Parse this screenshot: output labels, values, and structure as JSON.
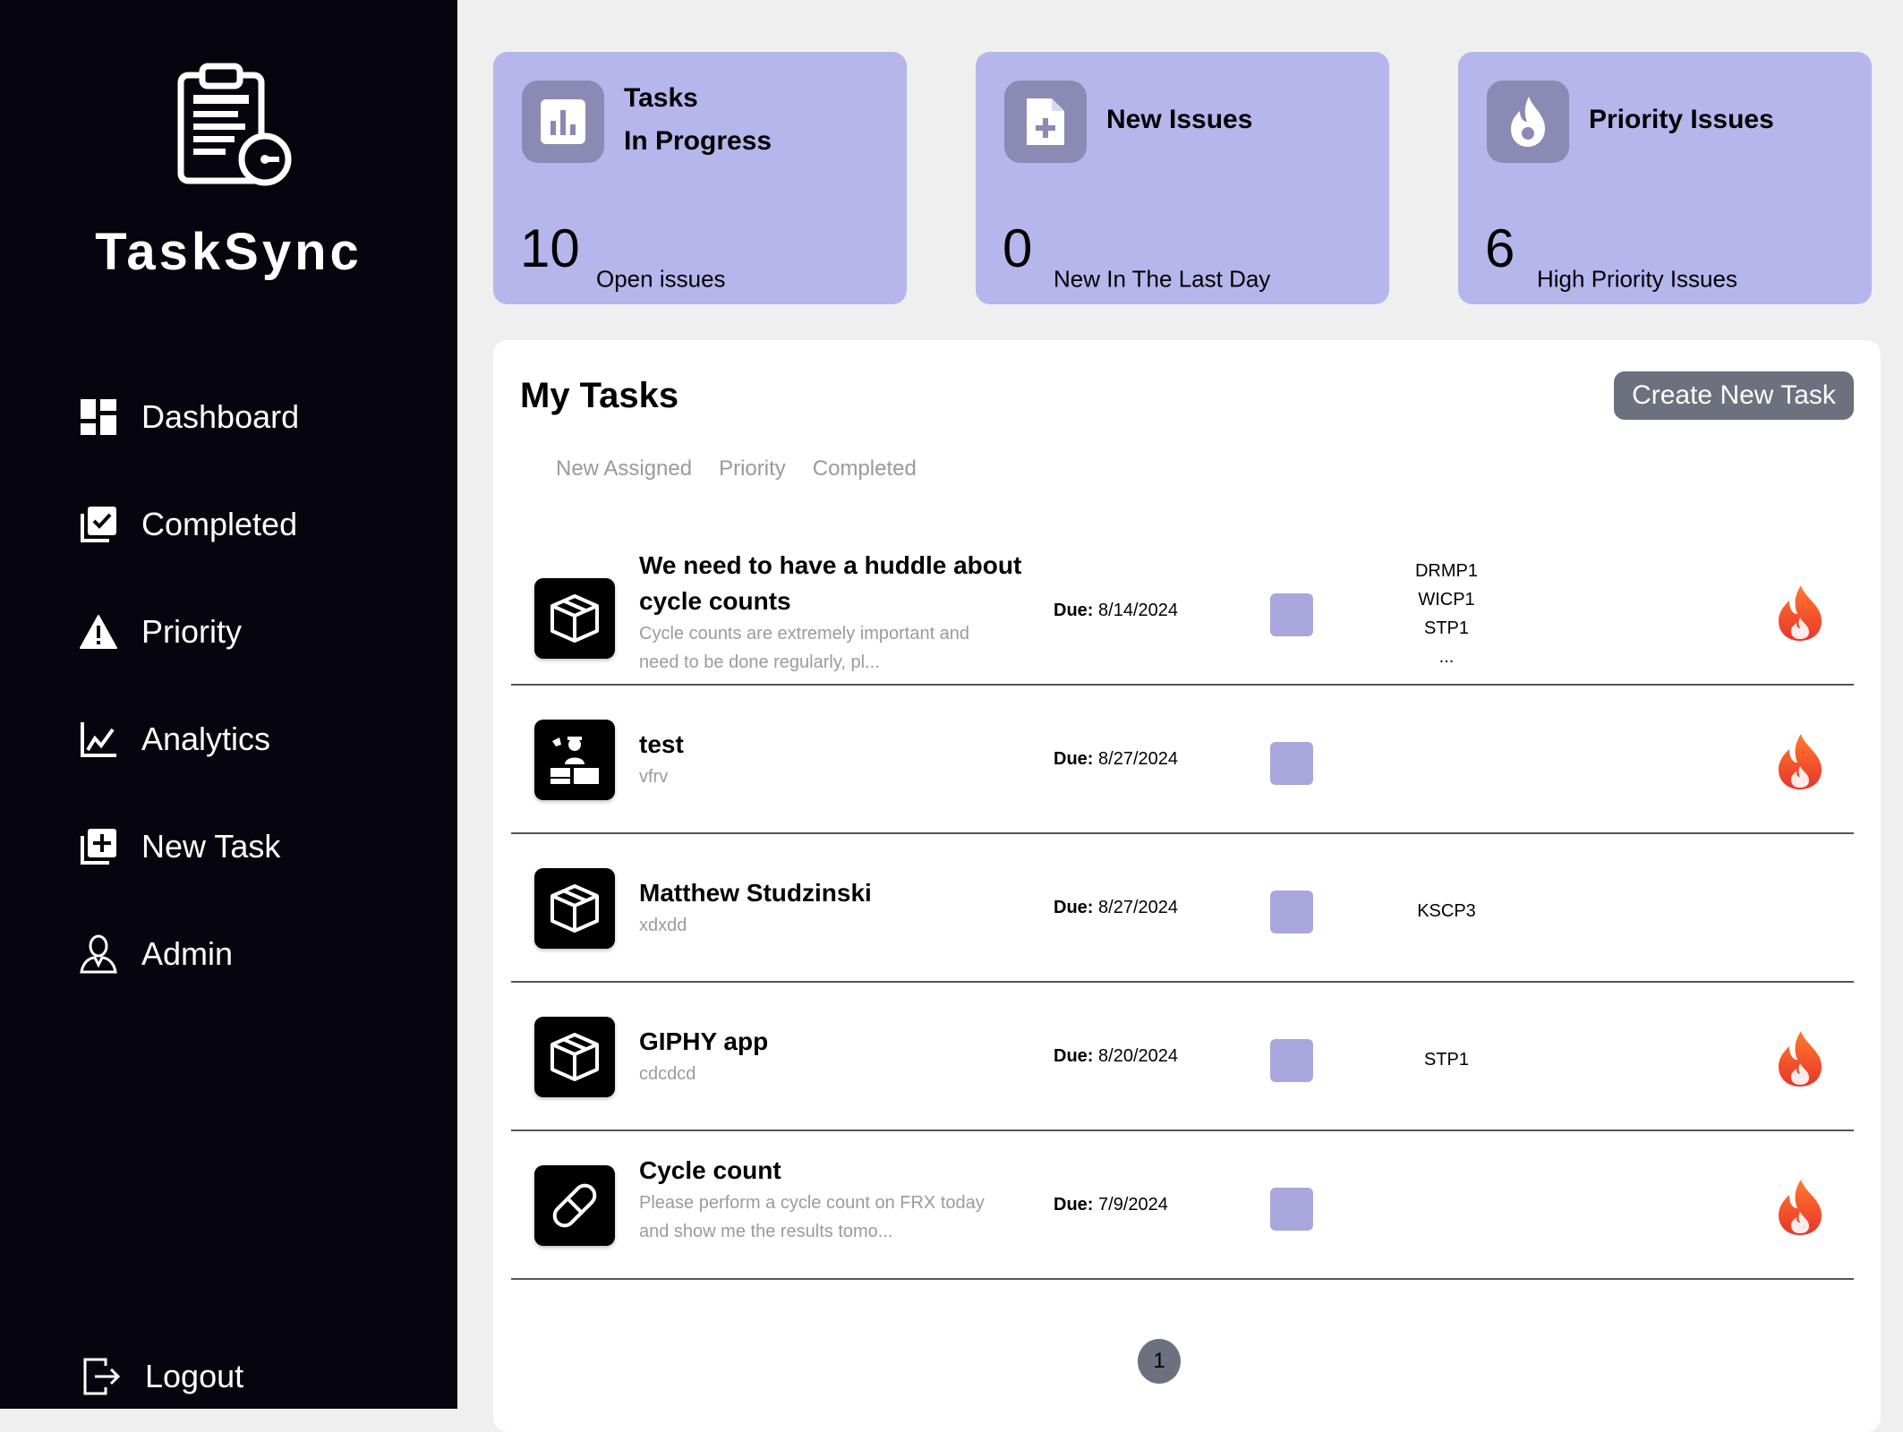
{
  "app": {
    "name": "TaskSync"
  },
  "sidebar": {
    "items": [
      {
        "label": "Dashboard",
        "icon": "dashboard-icon"
      },
      {
        "label": "Completed",
        "icon": "completed-check-icon"
      },
      {
        "label": "Priority",
        "icon": "warning-icon"
      },
      {
        "label": "Analytics",
        "icon": "analytics-chart-icon"
      },
      {
        "label": "New Task",
        "icon": "add-task-icon"
      },
      {
        "label": "Admin",
        "icon": "admin-user-icon"
      }
    ],
    "logout_label": "Logout"
  },
  "stats": [
    {
      "title_line1": "Tasks",
      "title_line2": "In Progress",
      "value": "10",
      "subtitle": "Open issues",
      "icon": "bar-chart-icon"
    },
    {
      "title_line1": "New Issues",
      "value": "0",
      "subtitle": "New In The Last Day",
      "icon": "file-add-icon"
    },
    {
      "title_line1": "Priority Issues",
      "value": "6",
      "subtitle": "High Priority Issues",
      "icon": "flame-icon"
    }
  ],
  "tasks_panel": {
    "title": "My Tasks",
    "create_button": "Create New Task",
    "tabs": [
      "New Assigned",
      "Priority",
      "Completed"
    ],
    "due_label": "Due:",
    "rows": [
      {
        "icon": "box-icon",
        "title_line1": "We need to have a huddle about",
        "title_line2": "cycle counts",
        "desc_line1": "Cycle counts are extremely important and",
        "desc_line2": "need to be done regularly, pl...",
        "due": "8/14/2024",
        "tags": [
          "DRMP1",
          "WICP1",
          "STP1",
          "..."
        ],
        "priority": true
      },
      {
        "icon": "worker-icon",
        "title_line1": "test",
        "desc_line1": "vfrv",
        "due": "8/27/2024",
        "tags": [],
        "priority": true
      },
      {
        "icon": "box-icon",
        "title_line1": "Matthew Studzinski",
        "desc_line1": "xdxdd",
        "due": "8/27/2024",
        "tags": [
          "KSCP3"
        ],
        "priority": false
      },
      {
        "icon": "box-icon",
        "title_line1": "GIPHY app",
        "desc_line1": "cdcdcd",
        "due": "8/20/2024",
        "tags": [
          "STP1"
        ],
        "priority": true
      },
      {
        "icon": "pill-icon",
        "title_line1": "Cycle count",
        "desc_line1": "Please perform a cycle count on FRX today",
        "desc_line2": "and show me the results tomo...",
        "due": "7/9/2024",
        "tags": [],
        "priority": true
      }
    ],
    "pagination": {
      "current_page": "1"
    }
  },
  "colors": {
    "sidebar_bg": "#06050d",
    "card_bg": "#b6b5ec",
    "status_box": "#a8a6dc",
    "button_bg": "#6c707f",
    "flame": "#f0532c"
  }
}
